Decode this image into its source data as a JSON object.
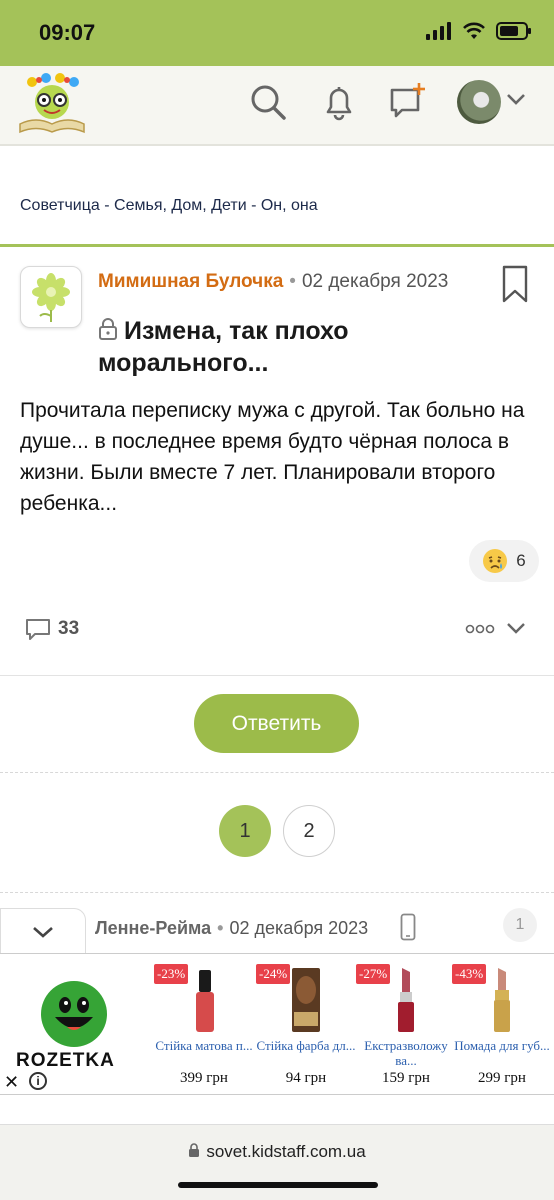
{
  "status_bar": {
    "time": "09:07"
  },
  "breadcrumb": "Советчица - Семья, Дом, Дети - Он, она",
  "post": {
    "author": "Мимишная Булочка",
    "date": "02 декабря 2023",
    "title_line1": "Измена, так плохо",
    "title_line2": "морального...",
    "body": "Прочитала переписку мужа с другой. Так больно на душе... в последнее время будто чёрная полоса в жизни. Были вместе 7 лет. Планировали второго ребенка...",
    "reaction_count": "6",
    "comment_count": "33"
  },
  "reply_button": "Ответить",
  "pagination": {
    "pages": [
      "1",
      "2"
    ],
    "current": "1"
  },
  "next_post": {
    "author": "Ленне-Рейма",
    "date": "02 декабря 2023",
    "number": "1"
  },
  "ad": {
    "brand": "ROZETKA",
    "products": [
      {
        "discount": "-23%",
        "name": "Стійка матова п...",
        "price": "399 грн"
      },
      {
        "discount": "-24%",
        "name": "Стійка фарба дл...",
        "price": "94 грн"
      },
      {
        "discount": "-27%",
        "name": "Екстразволожу ва...",
        "price": "159 грн"
      },
      {
        "discount": "-43%",
        "name": "Помада для губ...",
        "price": "299 грн"
      }
    ]
  },
  "url": "sovet.kidstaff.com.ua",
  "colors": {
    "accent": "#a4c259",
    "author": "#d36c13",
    "button": "#9cbb4a"
  }
}
